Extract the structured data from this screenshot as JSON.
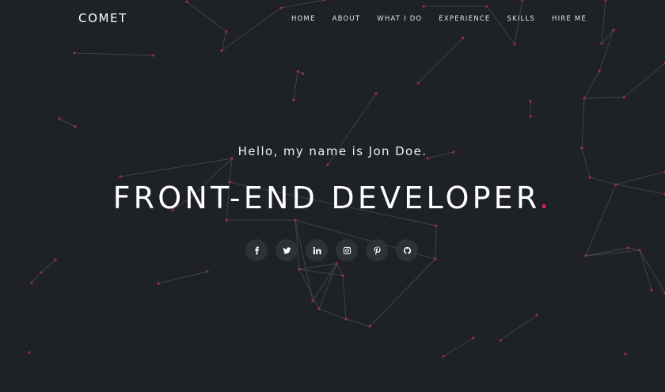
{
  "brand": {
    "name": "COMET"
  },
  "nav": {
    "items": [
      {
        "label": "HOME"
      },
      {
        "label": "ABOUT"
      },
      {
        "label": "WHAT I DO"
      },
      {
        "label": "EXPERIENCE"
      },
      {
        "label": "SKILLS"
      },
      {
        "label": "HIRE ME"
      }
    ]
  },
  "hero": {
    "greeting": "Hello, my name is Jon Doe.",
    "headline": "FRONT-END DEVELOPER",
    "headline_dot": ".",
    "accent_color": "#e0254f"
  },
  "social": {
    "icons": [
      "facebook-icon",
      "twitter-icon",
      "linkedin-icon",
      "instagram-icon",
      "pinterest-icon",
      "github-icon"
    ]
  },
  "theme": {
    "background": "#1e2125",
    "node_color": "#b0304a",
    "line_color": "#4a4e53"
  }
}
